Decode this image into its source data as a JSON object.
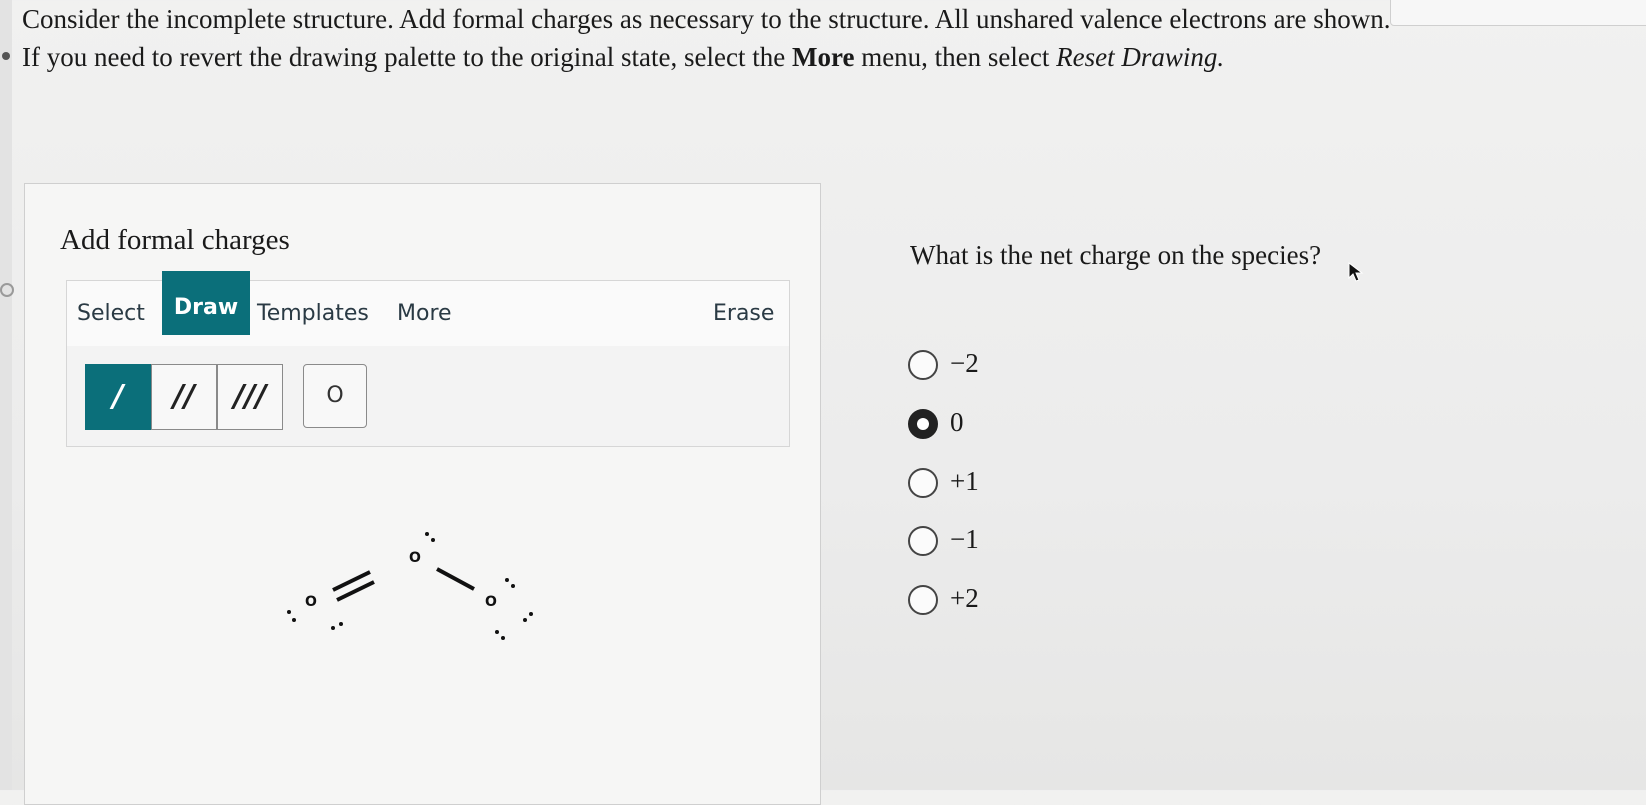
{
  "question": {
    "line1": "Consider the incomplete structure. Add formal charges as necessary to the structure. All unshared valence electrons are shown.",
    "line2_pre": "If you need to revert the drawing palette to the original state, select the ",
    "line2_bold": "More",
    "line2_mid": " menu, then select ",
    "line2_italic": "Reset Drawing."
  },
  "panel": {
    "title": "Add formal charges",
    "tabs": [
      "Select",
      "Draw",
      "Templates",
      "More"
    ],
    "active_tab": "Draw",
    "erase": "Erase",
    "tools": {
      "single_bond": "/",
      "double_bond": "//",
      "triple_bond": "///",
      "atom": "O"
    },
    "molecule": {
      "atoms": [
        "O",
        "O",
        "O"
      ],
      "bonds": [
        "double",
        "single"
      ]
    }
  },
  "net_charge_question": "What is the net charge on the species?",
  "options": [
    {
      "label": "−2",
      "selected": false
    },
    {
      "label": "0",
      "selected": true
    },
    {
      "label": "+1",
      "selected": false
    },
    {
      "label": "−1",
      "selected": false
    },
    {
      "label": "+2",
      "selected": false
    }
  ],
  "colors": {
    "accent": "#0b6f7a"
  }
}
